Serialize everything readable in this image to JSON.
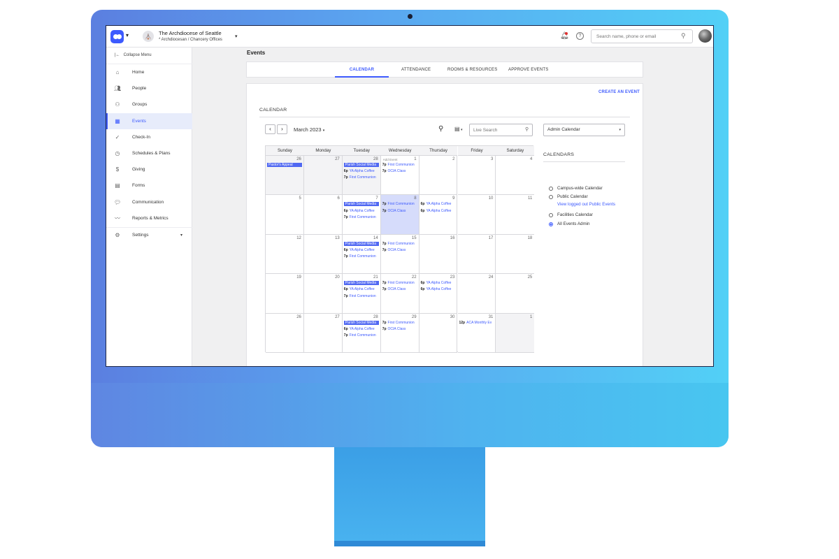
{
  "topbar": {
    "org_name": "The Archdiocese of Seattle",
    "org_sub": "* Archdiocesan / Chancery Offices",
    "search_placeholder": "Search name, phone or email"
  },
  "sidebar": {
    "collapse_label": "Collapse Menu",
    "items": [
      {
        "label": "Home",
        "icon": "home-icon"
      },
      {
        "label": "People",
        "icon": "people-icon"
      },
      {
        "label": "Groups",
        "icon": "groups-icon"
      },
      {
        "label": "Events",
        "icon": "calendar-icon"
      },
      {
        "label": "Check-In",
        "icon": "check-in-icon"
      },
      {
        "label": "Schedules & Plans",
        "icon": "clock-icon"
      },
      {
        "label": "Giving",
        "icon": "dollar-icon"
      },
      {
        "label": "Forms",
        "icon": "clipboard-icon"
      },
      {
        "label": "Communication",
        "icon": "chat-icon"
      },
      {
        "label": "Reports & Metrics",
        "icon": "metrics-icon"
      },
      {
        "label": "Settings",
        "icon": "gear-icon"
      }
    ]
  },
  "page": {
    "title": "Events"
  },
  "tabs": [
    "CALENDAR",
    "ATTENDANCE",
    "ROOMS & RESOURCES",
    "APPROVE EVENTS"
  ],
  "calendar": {
    "create_label": "CREATE AN EVENT",
    "section_label": "CALENDAR",
    "month_label": "March 2023",
    "live_search_placeholder": "Live Search",
    "admin_select": "Admin Calendar",
    "weekdays": [
      "Sunday",
      "Monday",
      "Tuesday",
      "Wednesday",
      "Thursday",
      "Friday",
      "Saturday"
    ],
    "add_event_label": "Add Event",
    "weeks": [
      [
        {
          "day": "26",
          "other": true,
          "events": [
            {
              "title": "Pastor's Appeal",
              "block": true
            }
          ]
        },
        {
          "day": "27",
          "other": true,
          "events": []
        },
        {
          "day": "28",
          "other": true,
          "events": [
            {
              "title": "Parish Social Media",
              "block": true
            },
            {
              "time": "6p",
              "title": "YA Alpha Coffee"
            },
            {
              "time": "7p",
              "title": "First Communion"
            }
          ]
        },
        {
          "day": "1",
          "add": true,
          "events": [
            {
              "time": "7p",
              "title": "First Communion"
            },
            {
              "time": "7p",
              "title": "OCIA Class"
            }
          ]
        },
        {
          "day": "2",
          "events": []
        },
        {
          "day": "3",
          "events": []
        },
        {
          "day": "4",
          "events": []
        }
      ],
      [
        {
          "day": "5",
          "events": []
        },
        {
          "day": "6",
          "events": []
        },
        {
          "day": "7",
          "events": [
            {
              "title": "Parish Social Media",
              "block": true
            },
            {
              "time": "6p",
              "title": "YA Alpha Coffee"
            },
            {
              "time": "7p",
              "title": "First Communion"
            }
          ]
        },
        {
          "day": "8",
          "today": true,
          "events": [
            {
              "time": "7p",
              "title": "First Communion"
            },
            {
              "time": "7p",
              "title": "OCIA Class"
            }
          ]
        },
        {
          "day": "9",
          "events": [
            {
              "time": "6p",
              "title": "YA Alpha Coffee"
            },
            {
              "time": "6p",
              "title": "YA Alpha Coffee"
            }
          ]
        },
        {
          "day": "10",
          "events": []
        },
        {
          "day": "11",
          "events": []
        }
      ],
      [
        {
          "day": "12",
          "events": []
        },
        {
          "day": "13",
          "events": []
        },
        {
          "day": "14",
          "events": [
            {
              "title": "Parish Social Media",
              "block": true
            },
            {
              "time": "6p",
              "title": "YA Alpha Coffee"
            },
            {
              "time": "7p",
              "title": "First Communion"
            }
          ]
        },
        {
          "day": "15",
          "events": [
            {
              "time": "7p",
              "title": "First Communion"
            },
            {
              "time": "7p",
              "title": "OCIA Class"
            }
          ]
        },
        {
          "day": "16",
          "events": []
        },
        {
          "day": "17",
          "events": []
        },
        {
          "day": "18",
          "events": []
        }
      ],
      [
        {
          "day": "19",
          "events": []
        },
        {
          "day": "20",
          "events": []
        },
        {
          "day": "21",
          "events": [
            {
              "title": "Parish Social Media",
              "block": true
            },
            {
              "time": "6p",
              "title": "YA Alpha Coffee"
            },
            {
              "time": "7p",
              "title": "First Communion"
            }
          ]
        },
        {
          "day": "22",
          "events": [
            {
              "time": "7p",
              "title": "First Communion"
            },
            {
              "time": "7p",
              "title": "OCIA Class"
            }
          ]
        },
        {
          "day": "23",
          "events": [
            {
              "time": "6p",
              "title": "YA Alpha Coffee"
            },
            {
              "time": "6p",
              "title": "YA Alpha Coffee"
            }
          ]
        },
        {
          "day": "24",
          "events": []
        },
        {
          "day": "25",
          "events": []
        }
      ],
      [
        {
          "day": "26",
          "events": []
        },
        {
          "day": "27",
          "events": []
        },
        {
          "day": "28",
          "events": [
            {
              "title": "Parish Social Media",
              "block": true
            },
            {
              "time": "6p",
              "title": "YA Alpha Coffee"
            },
            {
              "time": "7p",
              "title": "First Communion"
            }
          ]
        },
        {
          "day": "29",
          "events": [
            {
              "time": "7p",
              "title": "First Communion"
            },
            {
              "time": "7p",
              "title": "OCIA Class"
            }
          ]
        },
        {
          "day": "30",
          "events": []
        },
        {
          "day": "31",
          "events": [
            {
              "time": "12p",
              "title": "ACA Monthly Ev"
            }
          ]
        },
        {
          "day": "1",
          "other": true,
          "events": []
        }
      ]
    ]
  },
  "calendars_panel": {
    "title": "CALENDARS",
    "options": [
      {
        "label": "Campus-wide Calendar",
        "selected": false
      },
      {
        "label": "Public Calendar",
        "selected": false
      },
      {
        "label": "Facilities Calendar",
        "selected": false
      },
      {
        "label": "All Events Admin",
        "selected": true
      }
    ],
    "public_link": "View logged out Public Events"
  },
  "colors": {
    "accent": "#3d5afe",
    "event_block": "#5068f2",
    "today": "#d6dcfb"
  }
}
